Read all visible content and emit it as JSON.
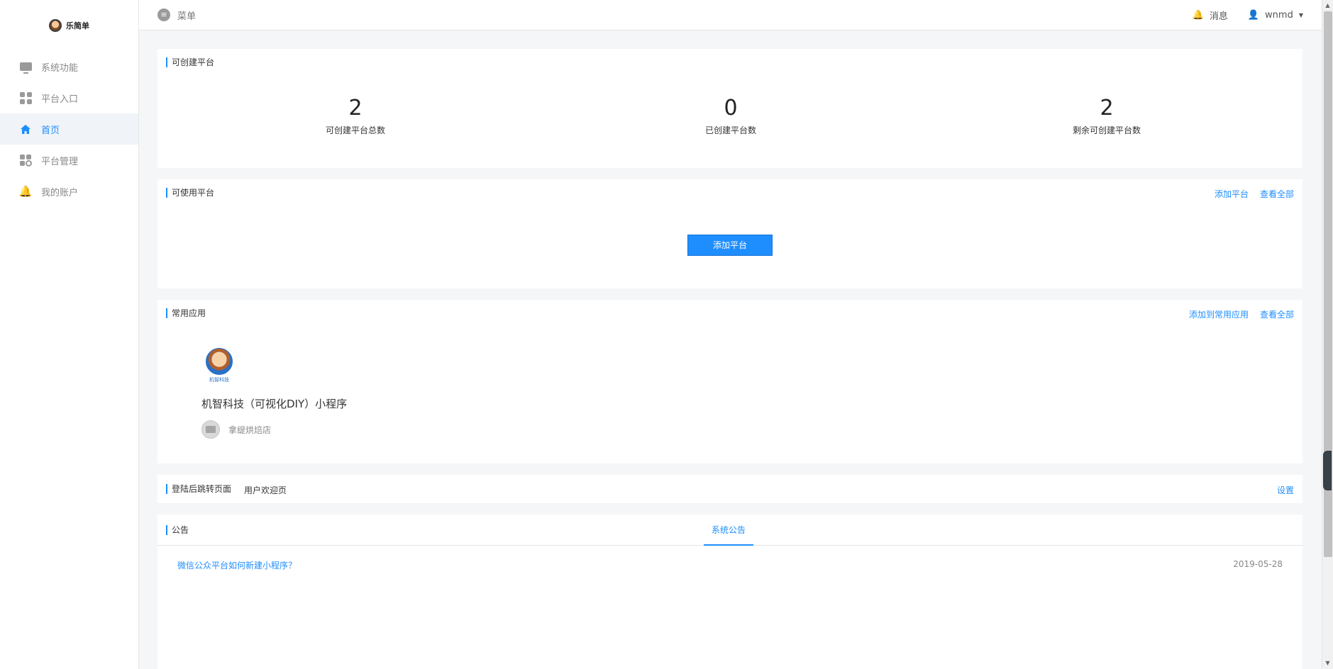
{
  "brand": {
    "logo_text": "乐简单"
  },
  "sidebar": {
    "items": [
      {
        "label": "系统功能",
        "icon": "monitor-icon"
      },
      {
        "label": "平台入口",
        "icon": "grid-icon"
      },
      {
        "label": "首页",
        "icon": "home-icon",
        "active": true
      },
      {
        "label": "平台管理",
        "icon": "grid-settings-icon"
      },
      {
        "label": "我的账户",
        "icon": "bell-icon"
      }
    ]
  },
  "topbar": {
    "menu_label": "菜单",
    "messages_label": "消息",
    "username": "wnmd"
  },
  "stats_card": {
    "title": "可创建平台",
    "stats": [
      {
        "value": "2",
        "label": "可创建平台总数"
      },
      {
        "value": "0",
        "label": "已创建平台数"
      },
      {
        "value": "2",
        "label": "剩余可创建平台数"
      }
    ]
  },
  "platforms_card": {
    "title": "可使用平台",
    "actions": [
      "添加平台",
      "查看全部"
    ],
    "add_button": "添加平台"
  },
  "apps_card": {
    "title": "常用应用",
    "actions": [
      "添加到常用应用",
      "查看全部"
    ],
    "app": {
      "logo_caption": "机智科技",
      "name": "机智科技（可视化DIY）小程序",
      "shop": "拿缇烘焙店"
    }
  },
  "redirect_card": {
    "title": "登陆后跳转页面",
    "value": "用户欢迎页",
    "action": "设置"
  },
  "notice_card": {
    "title": "公告",
    "tab": "系统公告",
    "items": [
      {
        "title": "微信公众平台如何新建小程序？",
        "date": "2019-05-28"
      }
    ]
  },
  "colors": {
    "accent": "#1e8eff",
    "background": "#f5f6f8"
  }
}
